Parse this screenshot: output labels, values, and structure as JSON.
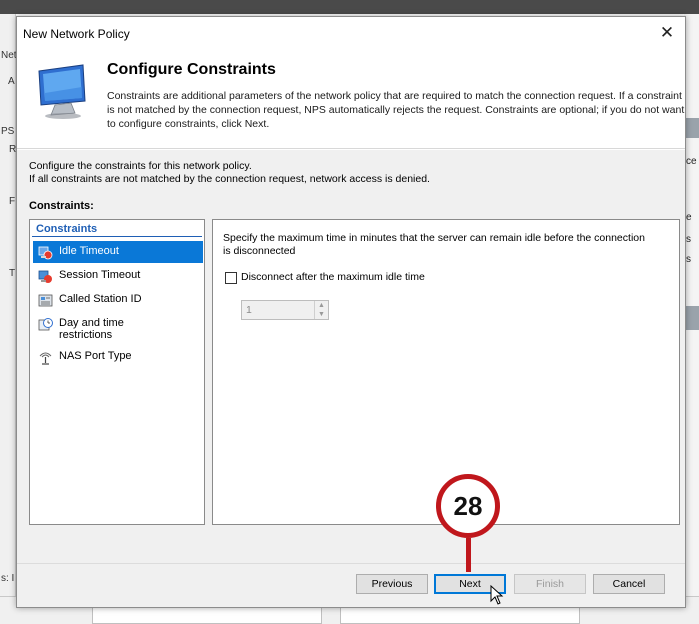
{
  "background": {
    "left_fragments": [
      "Neth",
      "A",
      "PS",
      "R",
      "F",
      "T"
    ],
    "right_fragments": [
      "ce",
      "e",
      "s",
      "s"
    ],
    "bottom_fragment": "s: I"
  },
  "dialog": {
    "title": "New Network Policy",
    "close_glyph": "✕",
    "header": {
      "title": "Configure Constraints",
      "description": "Constraints are additional parameters of the network policy that are required to match the connection request. If a constraint is not matched by the connection request, NPS automatically rejects the request. Constraints are optional; if you do not want to configure constraints, click Next."
    },
    "intro_line1": "Configure the constraints for this network policy.",
    "intro_line2": "If all constraints are not matched by the connection request, network access is denied.",
    "constraints_label": "Constraints:",
    "list": {
      "header": "Constraints",
      "items": [
        {
          "label": "Idle Timeout",
          "icon": "idle-timeout-icon",
          "selected": true
        },
        {
          "label": "Session Timeout",
          "icon": "session-timeout-icon",
          "selected": false
        },
        {
          "label": "Called Station ID",
          "icon": "called-station-icon",
          "selected": false
        },
        {
          "label": "Day and time restrictions",
          "icon": "clock-icon",
          "selected": false
        },
        {
          "label": "NAS Port Type",
          "icon": "antenna-icon",
          "selected": false
        }
      ]
    },
    "panel": {
      "description": "Specify the maximum time in minutes that the server can remain idle before the connection is disconnected",
      "checkbox_label": "Disconnect after the maximum idle time",
      "checkbox_checked": false,
      "spinner_value": "1"
    },
    "buttons": {
      "previous": "Previous",
      "next": "Next",
      "finish": "Finish",
      "cancel": "Cancel"
    }
  },
  "annotation": {
    "step_number": "28",
    "color": "#c0171c"
  },
  "colors": {
    "selection": "#0a78d7",
    "list_header": "#1f5fb5"
  }
}
